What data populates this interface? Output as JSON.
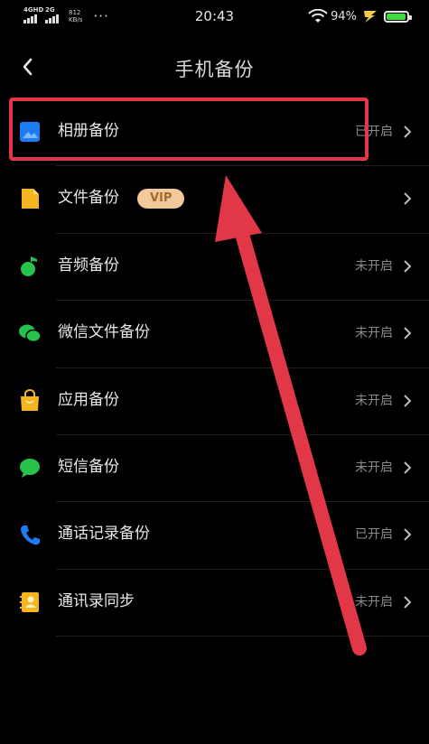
{
  "status_bar": {
    "network_1": "4GHD",
    "network_2": "2G",
    "speed_value": "812",
    "speed_unit": "KB/s",
    "more": "···",
    "time": "20:43",
    "battery_percent": "94%",
    "battery_level": 0.94,
    "battery_color": "#3ddc3d"
  },
  "header": {
    "title": "手机备份",
    "back_icon": "chevron-left-icon"
  },
  "items": [
    {
      "label": "相册备份",
      "status": "已开启",
      "icon": "photo-album-icon",
      "icon_color": "#1e7cf2"
    },
    {
      "label": "文件备份",
      "badge": "VIP",
      "status": "",
      "icon": "file-icon",
      "icon_color": "#f5b51e"
    },
    {
      "label": "音频备份",
      "status": "未开启",
      "icon": "music-note-icon",
      "icon_color": "#27c24c"
    },
    {
      "label": "微信文件备份",
      "status": "未开启",
      "icon": "wechat-icon",
      "icon_color": "#27c24c"
    },
    {
      "label": "应用备份",
      "status": "未开启",
      "icon": "app-bag-icon",
      "icon_color": "#f5b51e"
    },
    {
      "label": "短信备份",
      "status": "未开启",
      "icon": "message-icon",
      "icon_color": "#27c24c"
    },
    {
      "label": "通话记录备份",
      "status": "已开启",
      "icon": "phone-icon",
      "icon_color": "#1e7cf2"
    },
    {
      "label": "通讯录同步",
      "status": "未开启",
      "icon": "contacts-icon",
      "icon_color": "#f5b51e"
    }
  ],
  "annotation": {
    "highlight_color": "#e23746"
  }
}
